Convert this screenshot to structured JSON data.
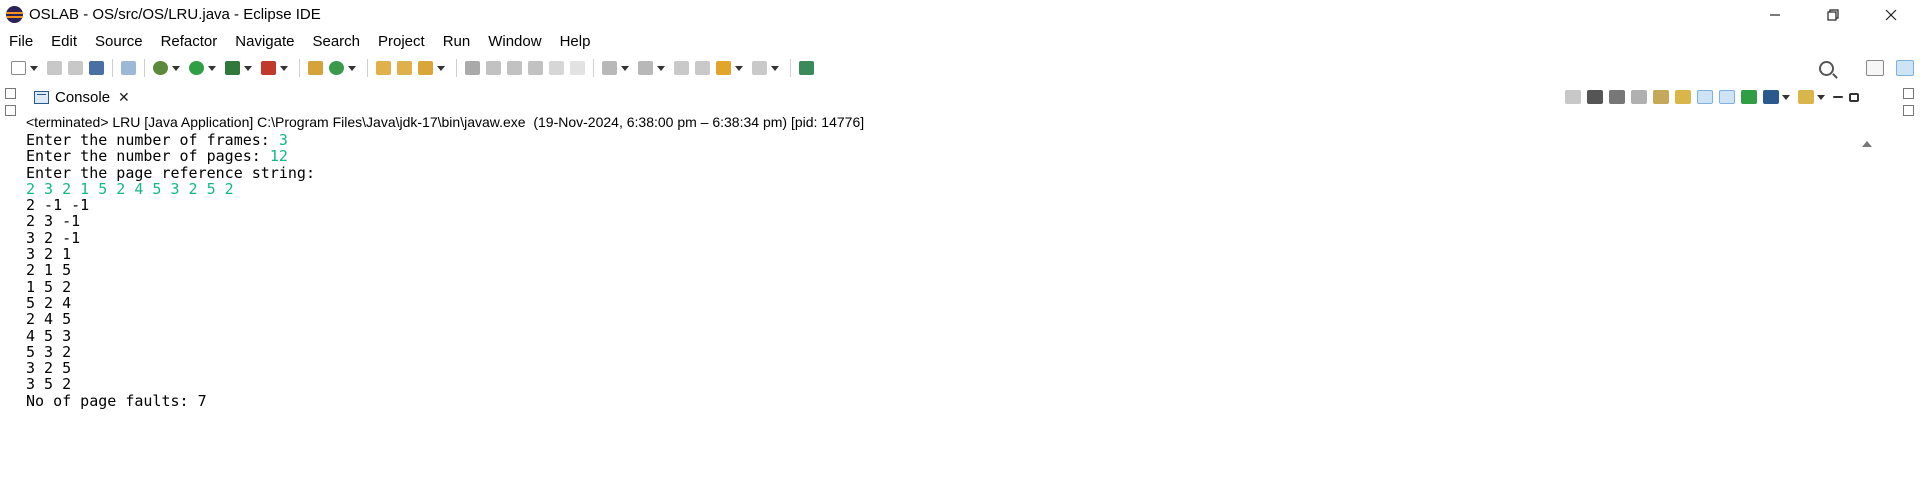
{
  "window": {
    "title": "OSLAB - OS/src/OS/LRU.java - Eclipse IDE",
    "controls": [
      "minimize-icon",
      "restore-icon",
      "close-icon"
    ]
  },
  "menu": [
    "File",
    "Edit",
    "Source",
    "Refactor",
    "Navigate",
    "Search",
    "Project",
    "Run",
    "Window",
    "Help"
  ],
  "toolbar": {
    "icons": [
      "new-icon",
      "save-icon",
      "save-all-icon",
      "terminal-icon",
      "skip-breakpoints-icon",
      "debug-icon",
      "run-icon",
      "coverage-icon",
      "external-tools-icon",
      "new-package-icon",
      "new-class-icon",
      "open-type-icon",
      "open-task-icon",
      "search-toolbar-icon",
      "toggle-annotation-icon",
      "toggle-highlight-icon",
      "block-selection-icon",
      "show-whitespace-icon",
      "next-annotation-icon",
      "previous-annotation-icon",
      "last-edit-icon",
      "back-icon",
      "forward-icon",
      "pin-editor-icon"
    ],
    "right_icons": [
      "search-icon",
      "open-perspective-icon",
      "java-perspective-icon"
    ]
  },
  "console": {
    "tab_label": "Console",
    "status": "<terminated> LRU [Java Application] C:\\Program Files\\Java\\jdk-17\\bin\\javaw.exe  (19-Nov-2024, 6:38:00 pm – 6:38:34 pm) [pid: 14776]",
    "lines": [
      {
        "prompt": "Enter the number of frames: ",
        "input": "3"
      },
      {
        "prompt": "Enter the number of pages: ",
        "input": "12"
      },
      {
        "prompt": "Enter the page reference string:",
        "input": ""
      },
      {
        "prompt": "",
        "input": "2 3 2 1 5 2 4 5 3 2 5 2"
      },
      {
        "prompt": "2 -1 -1",
        "input": ""
      },
      {
        "prompt": "2 3 -1",
        "input": ""
      },
      {
        "prompt": "3 2 -1",
        "input": ""
      },
      {
        "prompt": "3 2 1",
        "input": ""
      },
      {
        "prompt": "2 1 5",
        "input": ""
      },
      {
        "prompt": "1 5 2",
        "input": ""
      },
      {
        "prompt": "5 2 4",
        "input": ""
      },
      {
        "prompt": "2 4 5",
        "input": ""
      },
      {
        "prompt": "4 5 3",
        "input": ""
      },
      {
        "prompt": "5 3 2",
        "input": ""
      },
      {
        "prompt": "3 2 5",
        "input": ""
      },
      {
        "prompt": "3 5 2",
        "input": ""
      },
      {
        "prompt": "No of page faults: 7",
        "input": ""
      }
    ],
    "view_toolbar_icons": [
      "terminate-icon",
      "remove-launch-icon",
      "remove-all-terminated-icon",
      "scroll-lock-icon",
      "word-wrap-icon",
      "show-on-stdout-icon",
      "show-on-stderr-icon",
      "pin-console-icon",
      "display-console-icon",
      "open-console-icon",
      "minimize-view-icon",
      "maximize-view-icon"
    ]
  },
  "colors": {
    "input_text": "#12b886",
    "accent": "#2a5a8c"
  }
}
